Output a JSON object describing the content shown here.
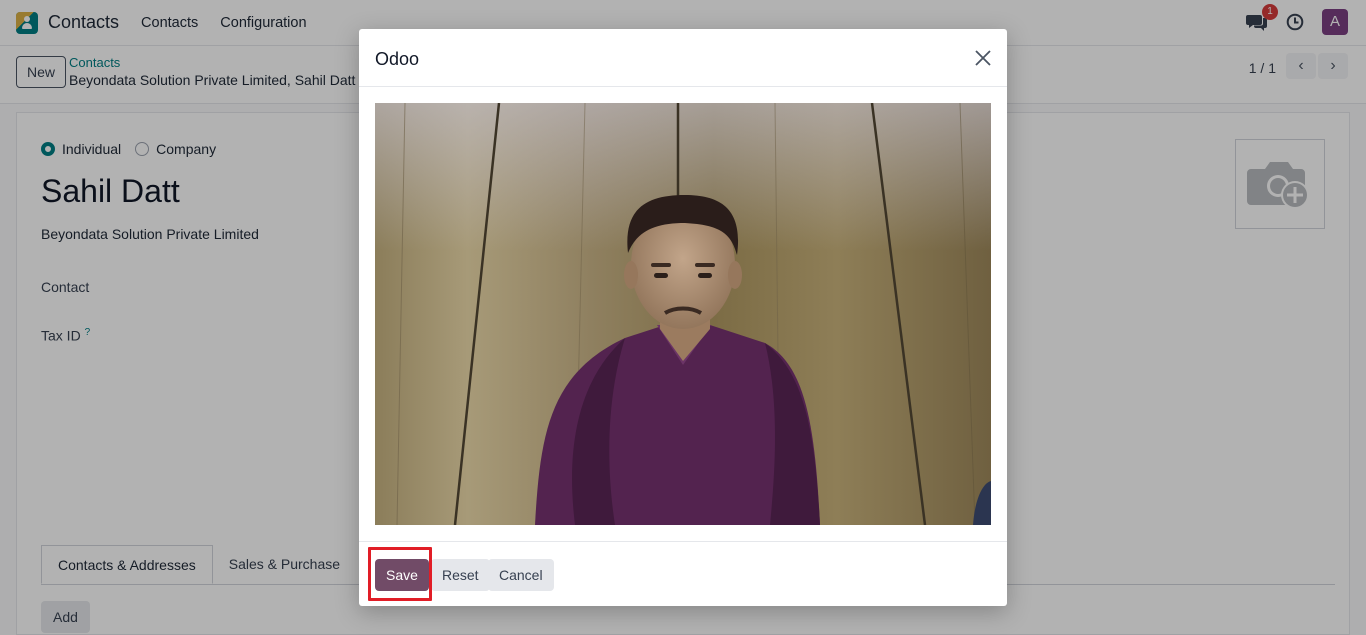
{
  "navbar": {
    "app_name": "Contacts",
    "menu": [
      "Contacts",
      "Configuration"
    ],
    "chat_badge": "1",
    "avatar_letter": "A"
  },
  "control": {
    "new_label": "New",
    "breadcrumb_parent": "Contacts",
    "breadcrumb_current": "Beyondata Solution Private Limited, Sahil Datt",
    "pager": "1 / 1"
  },
  "form": {
    "type_options": [
      "Individual",
      "Company"
    ],
    "selected_type": "Individual",
    "name": "Sahil Datt",
    "company": "Beyondata Solution Private Limited",
    "contact_label": "Contact",
    "tax_id_label": "Tax ID",
    "tax_id_help": "?",
    "tabs": [
      "Contacts & Addresses",
      "Sales & Purchase"
    ],
    "active_tab": "Contacts & Addresses",
    "add_label": "Add"
  },
  "dialog": {
    "title": "Odoo",
    "save_label": "Save",
    "reset_label": "Reset",
    "cancel_label": "Cancel"
  },
  "colors": {
    "brand": "#714b67",
    "accent": "#017e84",
    "highlight": "#e11d26"
  },
  "icons": [
    "contacts-app-icon",
    "chat-icon",
    "clock-icon",
    "chevron-left-icon",
    "chevron-right-icon",
    "camera-add-icon",
    "close-icon"
  ]
}
